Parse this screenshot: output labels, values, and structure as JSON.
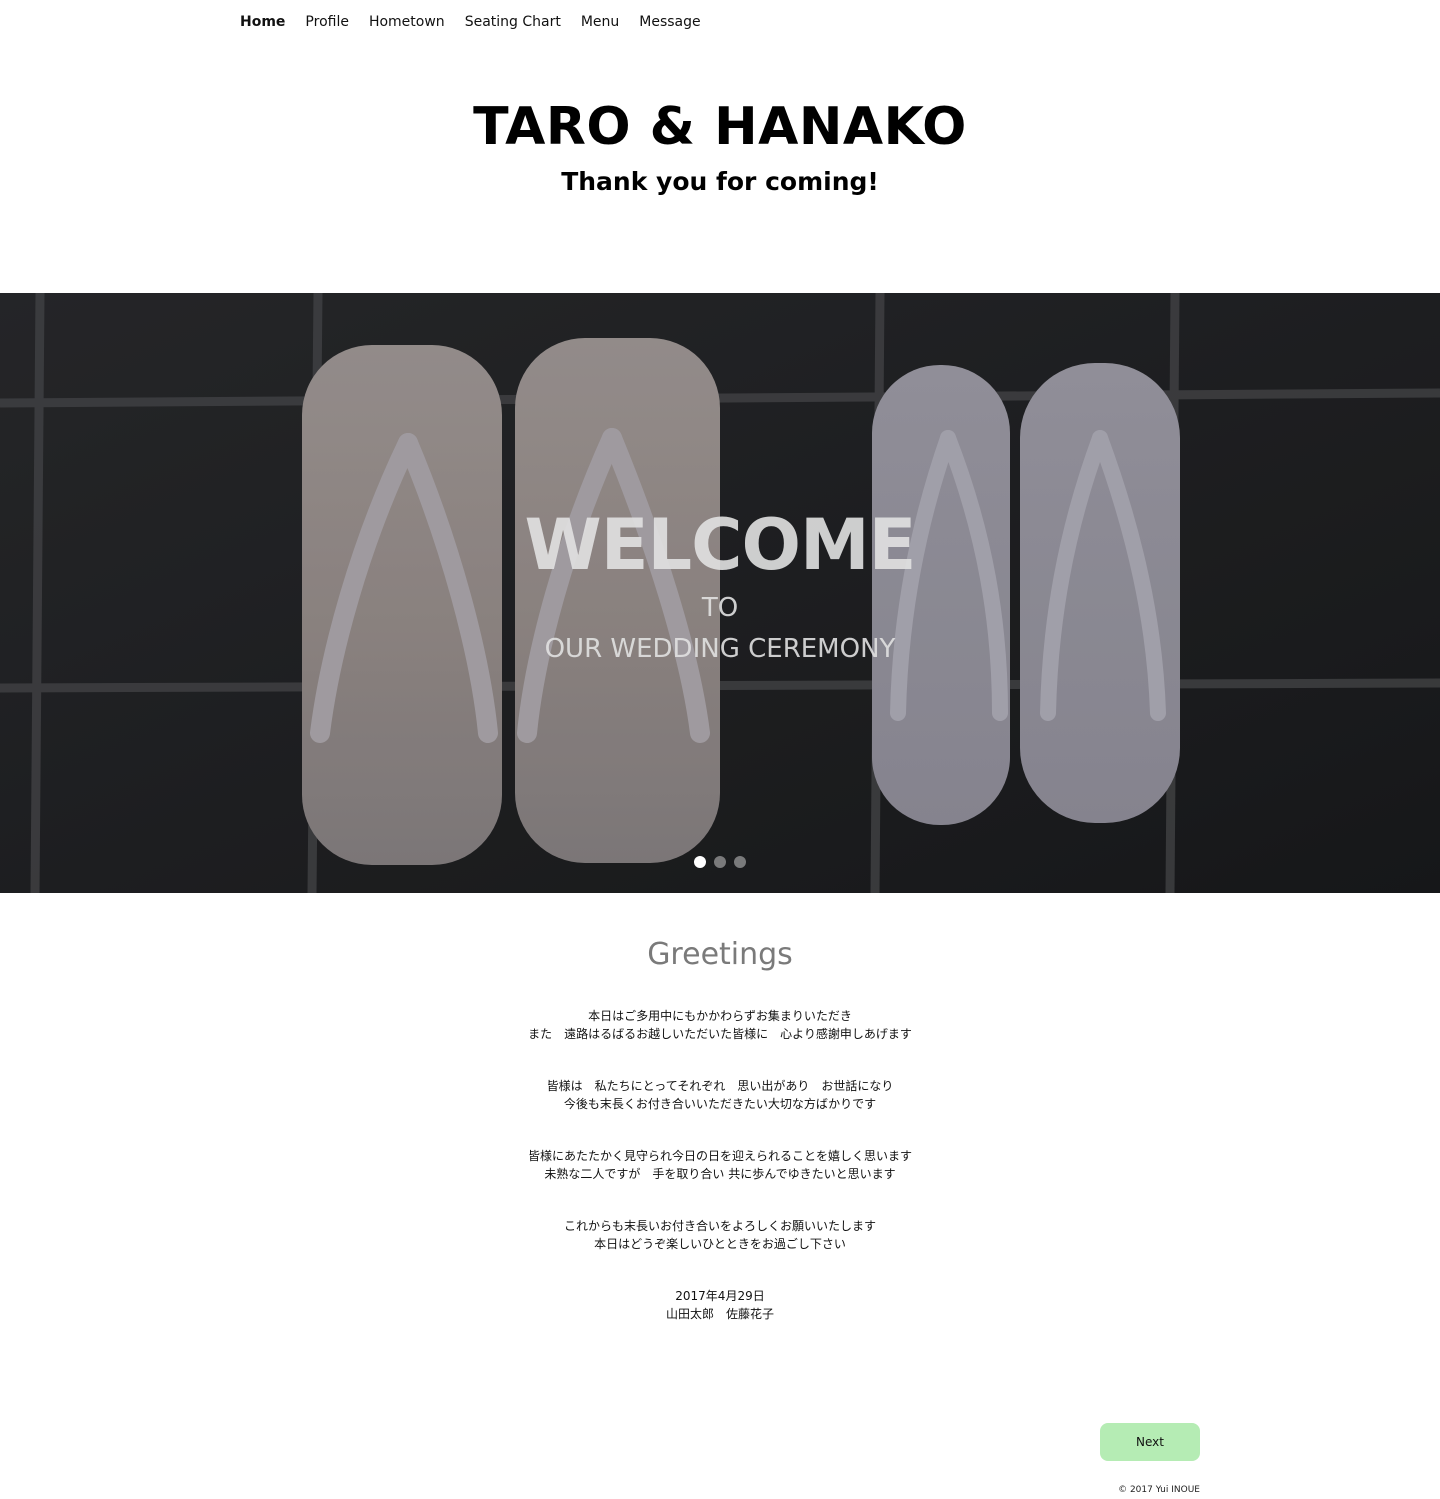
{
  "nav": {
    "items": [
      {
        "label": "Home",
        "active": true
      },
      {
        "label": "Profile"
      },
      {
        "label": "Hometown"
      },
      {
        "label": "Seating Chart"
      },
      {
        "label": "Menu"
      },
      {
        "label": "Message"
      }
    ]
  },
  "header": {
    "title": "TARO & HANAKO",
    "subtitle": "Thank you for coming!"
  },
  "hero": {
    "welcome": "WELCOME",
    "to": "TO",
    "ceremony": "OUR WEDDING CEREMONY",
    "slides": 3,
    "active_slide": 1,
    "image": "photo of two pairs of white zori sandals on dark stone tiles"
  },
  "greetings": {
    "title": "Greetings",
    "paragraphs": [
      [
        "本日はご多用中にもかかわらずお集まりいただき",
        "また　遠路はるばるお越しいただいた皆様に　心より感謝申しあげます"
      ],
      [
        "皆様は　私たちにとってそれぞれ　思い出があり　お世話になり",
        "今後も末長くお付き合いいただきたい大切な方ばかりです"
      ],
      [
        "皆様にあたたかく見守られ今日の日を迎えられることを嬉しく思います",
        "未熟な二人ですが　手を取り合い 共に歩んでゆきたいと思います"
      ],
      [
        "これからも末長いお付き合いをよろしくお願いいたします",
        "本日はどうぞ楽しいひとときをお過ごし下さい"
      ],
      [
        "2017年4月29日",
        "山田太郎　佐藤花子"
      ]
    ]
  },
  "buttons": {
    "next": "Next"
  },
  "footer": {
    "copyright": "© 2017 Yui INOUE"
  },
  "colors": {
    "next_button": "#b5ecb4",
    "greetings_title": "#7a7a7a",
    "hero_bg": "#1e1f21"
  }
}
